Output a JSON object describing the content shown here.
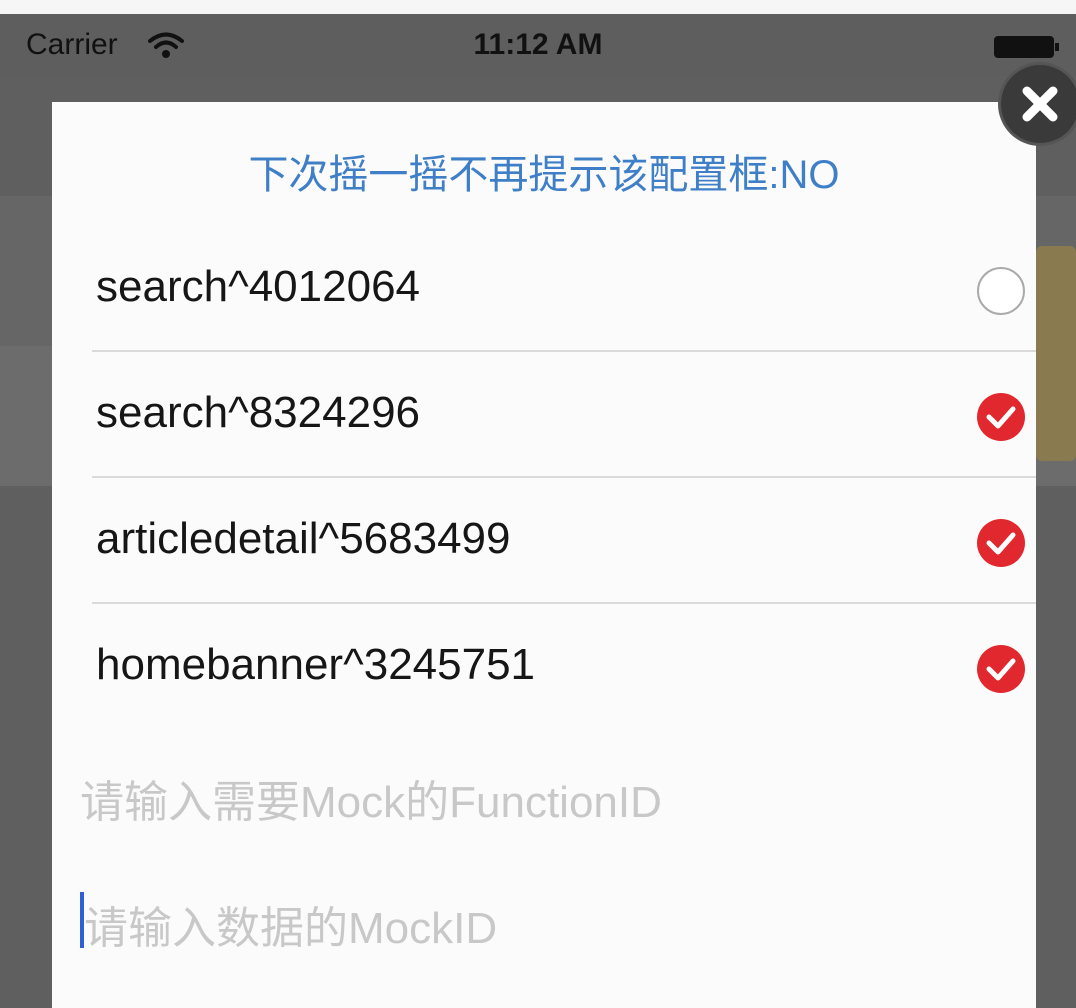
{
  "status_bar": {
    "carrier": "Carrier",
    "time": "11:12 AM"
  },
  "dialog": {
    "title": "下次摇一摇不再提示该配置框:NO",
    "title_color": "#3f7fc7",
    "check_color": "#e0282e",
    "items": [
      {
        "label": "search^4012064",
        "checked": false
      },
      {
        "label": "search^8324296",
        "checked": true
      },
      {
        "label": "articledetail^5683499",
        "checked": true
      },
      {
        "label": "homebanner^3245751",
        "checked": true
      }
    ],
    "function_id_input": {
      "placeholder": "请输入需要Mock的FunctionID",
      "value": ""
    },
    "mock_id_input": {
      "placeholder": "请输入数据的MockID",
      "value": ""
    }
  },
  "icons": {
    "wifi": "wifi-icon",
    "battery": "battery-icon",
    "close": "close-icon",
    "check": "checkmark-circle-icon",
    "unchecked": "empty-circle-icon"
  }
}
